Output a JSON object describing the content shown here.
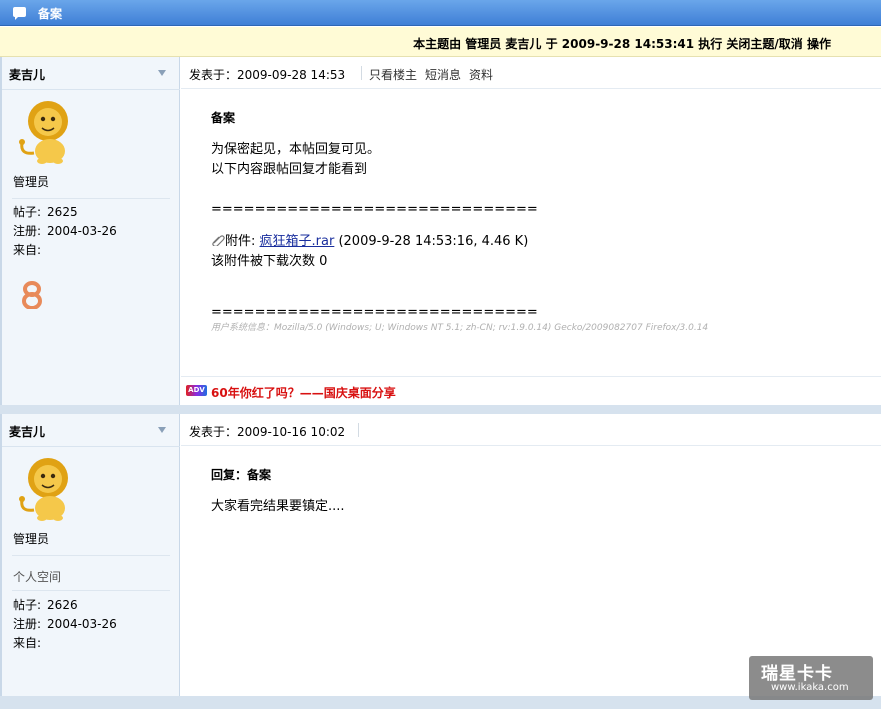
{
  "header": {
    "title": "备案"
  },
  "notice": {
    "text": "本主题由 管理员 麦吉儿 于 2009-9-28 14:53:41 执行 关闭主题/取消 操作"
  },
  "posts": [
    {
      "user": {
        "name": "麦吉儿",
        "role": "管理员",
        "stats": [
          {
            "label": "帖子:",
            "value": "2625"
          },
          {
            "label": "注册:",
            "value": "2004-03-26"
          },
          {
            "label": "来自:",
            "value": ""
          }
        ]
      },
      "meta": {
        "posted_at": "发表于：2009-09-28 14:53",
        "links": [
          "只看楼主",
          "短消息",
          "资料"
        ]
      },
      "body": {
        "subject": "备案",
        "lines": [
          "为保密起见，本帖回复可见。",
          "以下内容跟帖回复才能看到"
        ],
        "rule": "==============================",
        "attachment": {
          "prefix": "附件:",
          "filename": "疯狂箱子.rar",
          "info": "(2009-9-28 14:53:16, 4.46 K)",
          "downloads": "该附件被下载次数 0"
        },
        "user_agent": "用户系统信息：Mozilla/5.0 (Windows; U; Windows NT 5.1; zh-CN; rv:1.9.0.14) Gecko/2009082707 Firefox/3.0.14"
      },
      "ad": {
        "badge": "ADV",
        "text": "60年你红了吗？——国庆桌面分享"
      }
    },
    {
      "user": {
        "name": "麦吉儿",
        "role": "管理员",
        "space": "个人空间",
        "stats": [
          {
            "label": "帖子:",
            "value": "2626"
          },
          {
            "label": "注册:",
            "value": "2004-03-26"
          },
          {
            "label": "来自:",
            "value": ""
          }
        ]
      },
      "meta": {
        "posted_at": "发表于：2009-10-16 10:02"
      },
      "body": {
        "subject": "回复：备案",
        "lines": [
          "大家看完结果要镇定...."
        ]
      }
    }
  ],
  "watermark": {
    "line1": "瑞星卡卡",
    "line2": "www.ikaka.com"
  },
  "colors": {
    "topbar": "#4a8ce0",
    "notice_bg": "#fffbd6",
    "sidebar_bg": "#f1f6fb",
    "ad_text": "#d81111",
    "link": "#1a2f9e"
  }
}
